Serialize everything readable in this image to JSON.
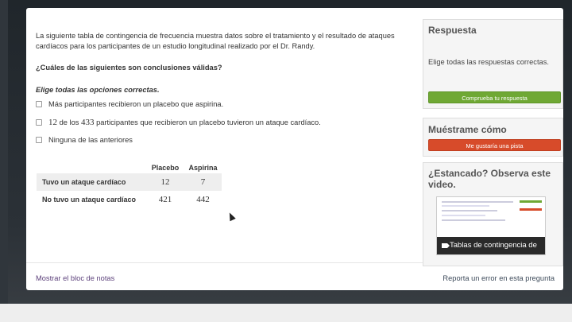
{
  "problem": {
    "intro": "La siguiente tabla de contingencia de frecuencia muestra datos sobre el tratamiento y el resultado de ataques cardíacos para los participantes de un estudio longitudinal realizado por el Dr. Randy.",
    "question": "¿Cuáles de las siguientes son conclusiones válidas?",
    "instructions": "Elige todas las opciones correctas.",
    "options": [
      {
        "text": "Más participantes recibieron un placebo que aspirina."
      },
      {
        "pre": "",
        "n1": "12",
        "mid": " de los ",
        "n2": "433",
        "post": " participantes que recibieron un placebo tuvieron un ataque cardíaco."
      },
      {
        "text": "Ninguna de las anteriores"
      }
    ],
    "table": {
      "headers": [
        "Placebo",
        "Aspirina"
      ],
      "rows": [
        {
          "label": "Tuvo un ataque cardíaco",
          "values": [
            "12",
            "7"
          ]
        },
        {
          "label": "No tuvo un ataque cardíaco",
          "values": [
            "421",
            "442"
          ]
        }
      ]
    }
  },
  "footer": {
    "notes_link": "Mostrar el bloc de notas",
    "report_link": "Reporta un error en esta pregunta"
  },
  "sidebar": {
    "answer": {
      "title": "Respuesta",
      "text": "Elige todas las respuestas correctas.",
      "button": "Comprueba tu respuesta"
    },
    "hint": {
      "title": "Muéstrame cómo",
      "button": "Me gustaría una pista"
    },
    "video": {
      "title": "¿Estancado? Observa este video.",
      "caption": "Tablas de contingencia de"
    }
  },
  "colors": {
    "accent_green": "#6fa834",
    "accent_red": "#d74b2a",
    "link_purple": "#5b3f7a"
  }
}
